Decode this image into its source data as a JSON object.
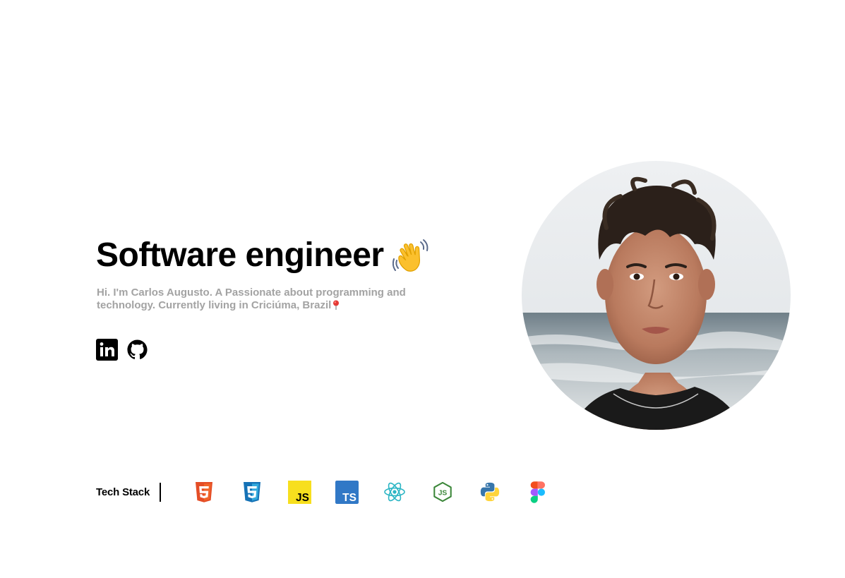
{
  "hero": {
    "title": "Software engineer",
    "title_emoji_icon": "waving-hand-icon",
    "bio": "Hi. I'm Carlos Augusto. A Passionate about programming and technology. Currently living in Criciúma, Brazil",
    "bio_emoji_icon": "round-pushpin-icon"
  },
  "socials": [
    {
      "name": "LinkedIn",
      "icon": "linkedin-icon"
    },
    {
      "name": "GitHub",
      "icon": "github-icon"
    }
  ],
  "avatar": {
    "alt": "Profile photo"
  },
  "tech_stack": {
    "label": "Tech Stack",
    "icons": [
      {
        "name": "HTML5",
        "icon": "html5-icon",
        "color": "#e44d26"
      },
      {
        "name": "CSS3",
        "icon": "css3-icon",
        "color": "#1572b6"
      },
      {
        "name": "JavaScript",
        "icon": "javascript-icon",
        "color": "#f7df1e"
      },
      {
        "name": "TypeScript",
        "icon": "typescript-icon",
        "color": "#3178c6"
      },
      {
        "name": "React",
        "icon": "react-icon",
        "color": "#2bb5c4"
      },
      {
        "name": "Node.js",
        "icon": "nodejs-icon",
        "color": "#3c873a"
      },
      {
        "name": "Python",
        "icon": "python-icon",
        "color": "#3776ab"
      },
      {
        "name": "Figma",
        "icon": "figma-icon",
        "color": "#a259ff"
      }
    ]
  },
  "colors": {
    "text": "#000000",
    "muted": "#a3a3a3",
    "background": "#ffffff"
  }
}
